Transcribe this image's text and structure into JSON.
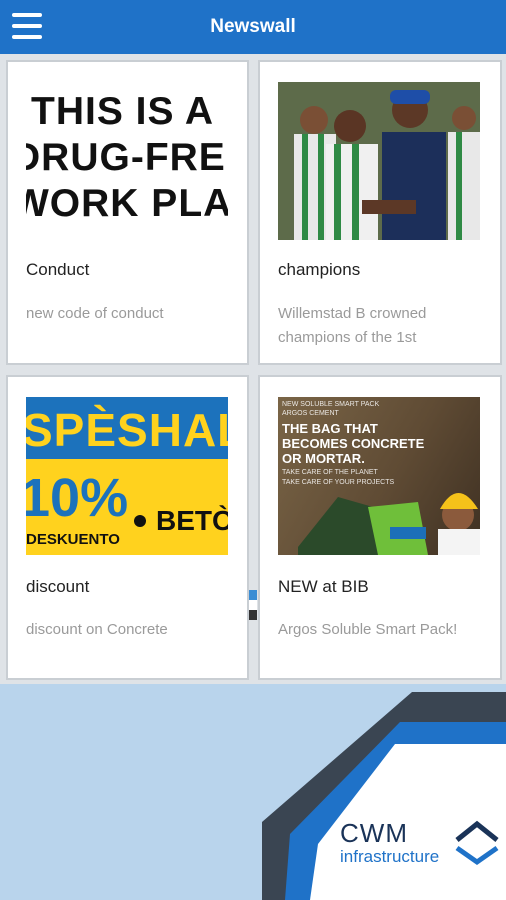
{
  "header": {
    "title": "Newswall",
    "menu_icon": "hamburger-menu-icon"
  },
  "cards": [
    {
      "title": "Conduct",
      "description": "new code of conduct",
      "image_text": [
        "THIS IS A",
        "DRUG-FREE",
        "WORK PLACE"
      ]
    },
    {
      "title": "champions",
      "description": "Willemstad B crowned champions of the 1st"
    },
    {
      "title": "discount",
      "description": "discount on Concrete",
      "image_text": {
        "headline": "SPÈSHAL",
        "percent": "10%",
        "bet": "BETÒ",
        "sub": "DESKUENTO"
      }
    },
    {
      "title": "NEW at BIB",
      "description": "Argos Soluble Smart Pack!",
      "image_text": {
        "line0": "NEW SOLUBLE SMART PACK",
        "line0b": "ARGOS CEMENT",
        "line1": "THE BAG THAT",
        "line2": "BECOMES CONCRETE",
        "line3": "OR MORTAR.",
        "line4": "TAKE CARE OF THE PLANET",
        "line5": "TAKE CARE OF YOUR PROJECTS"
      }
    }
  ],
  "brand": {
    "name": "CWM",
    "subtitle": "infrastructure"
  },
  "colors": {
    "accent": "#1f72c8",
    "dark": "#1a3358",
    "background": "#b9d4ec"
  }
}
